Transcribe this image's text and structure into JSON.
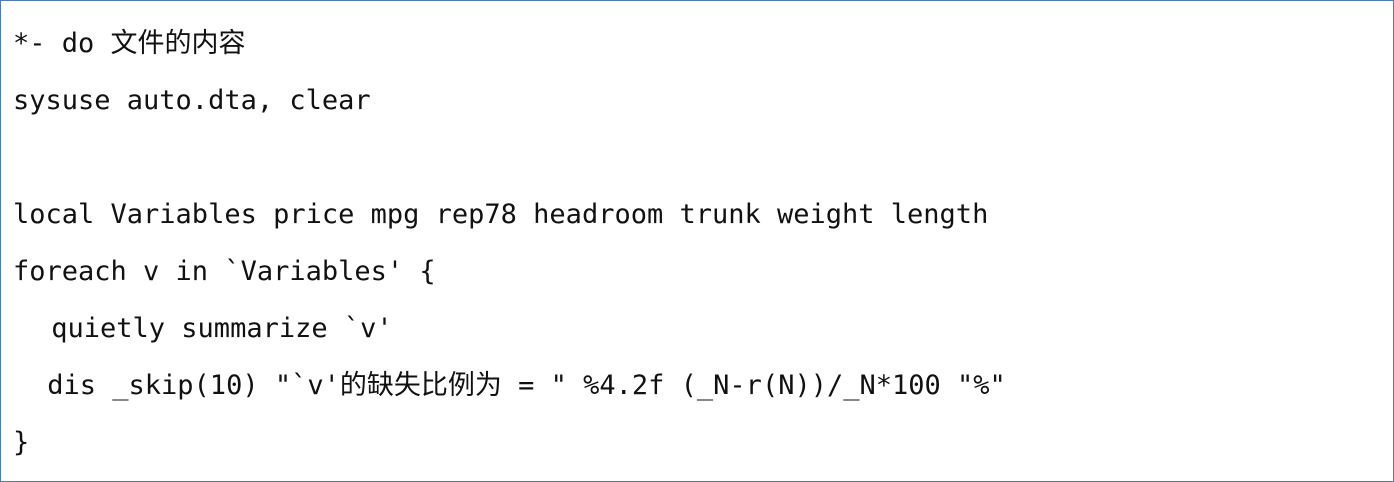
{
  "code": {
    "lines": [
      "*- do 文件的内容",
      "sysuse auto.dta, clear",
      "",
      "local Variables price mpg rep78 headroom trunk weight length",
      "foreach v in `Variables' {",
      " quietly summarize `v'",
      " dis _skip(10) \"`v'的缺失比例为 = \" %4.2f (_N-r(N))/_N*100 \"%\"",
      "}"
    ]
  },
  "colors": {
    "border": "#4f7cae",
    "text": "#111111",
    "background": "#ffffff"
  }
}
